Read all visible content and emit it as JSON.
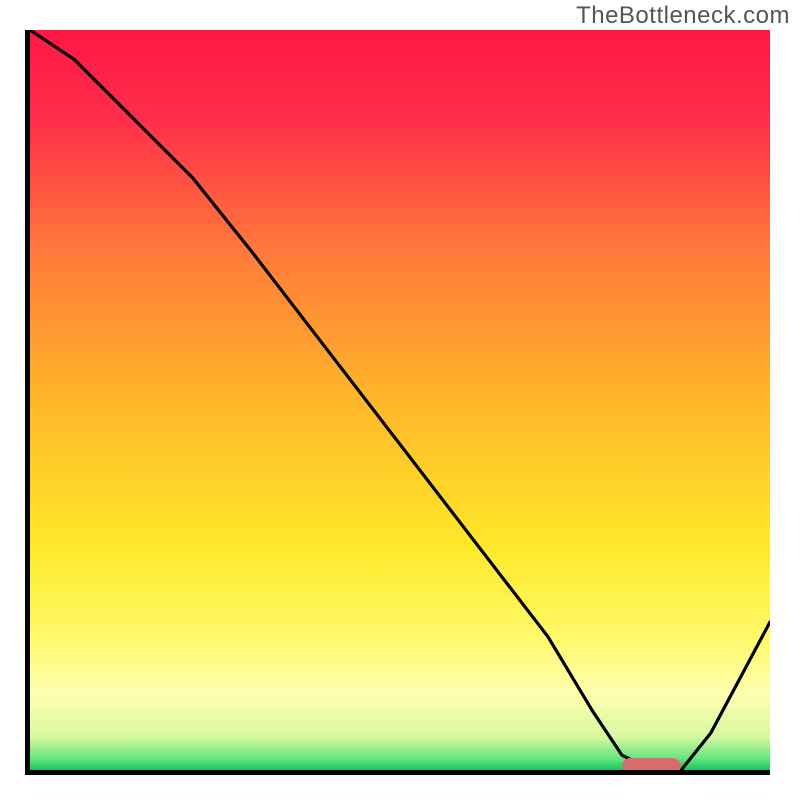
{
  "watermark_text": "TheBottleneck.com",
  "chart_data": {
    "type": "line",
    "title": "",
    "xlabel": "",
    "ylabel": "",
    "xlim": [
      0,
      100
    ],
    "ylim": [
      0,
      100
    ],
    "curve": {
      "name": "bottleneck-curve",
      "x": [
        0,
        6,
        22,
        30,
        40,
        50,
        60,
        70,
        76,
        80,
        84,
        88,
        92,
        100
      ],
      "y": [
        100,
        96,
        80,
        70,
        57,
        44,
        31,
        18,
        8,
        2,
        0,
        0,
        5,
        20
      ]
    },
    "optimal_zone": {
      "x_start": 80,
      "x_end": 88,
      "y": 0
    },
    "gradient_stops": [
      {
        "pos": 0.0,
        "color": "#ff1744"
      },
      {
        "pos": 0.12,
        "color": "#ff2e4a"
      },
      {
        "pos": 0.3,
        "color": "#ff7a3a"
      },
      {
        "pos": 0.5,
        "color": "#ffb62a"
      },
      {
        "pos": 0.7,
        "color": "#ffe92a"
      },
      {
        "pos": 0.82,
        "color": "#fff96a"
      },
      {
        "pos": 0.9,
        "color": "#fdffb0"
      },
      {
        "pos": 0.955,
        "color": "#d8f8a0"
      },
      {
        "pos": 0.985,
        "color": "#62e57e"
      },
      {
        "pos": 1.0,
        "color": "#18c45a"
      }
    ],
    "axes_visible": true,
    "legend": false,
    "grid": false
  }
}
